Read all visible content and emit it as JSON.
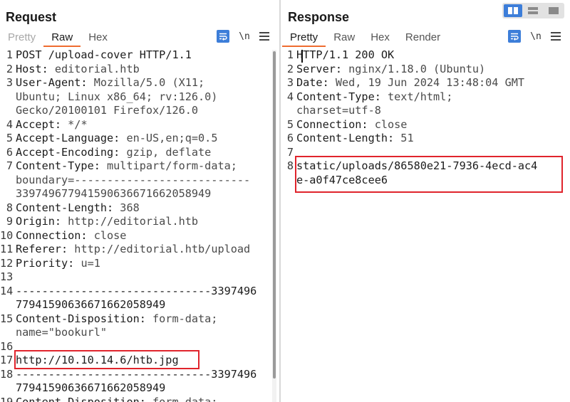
{
  "request": {
    "title": "Request",
    "tabs": [
      {
        "label": "Pretty",
        "state": "disabled"
      },
      {
        "label": "Raw",
        "state": "active"
      },
      {
        "label": "Hex",
        "state": "normal"
      }
    ],
    "newline_label": "\\n",
    "lines": [
      {
        "num": "1",
        "key": "POST /upload-cover HTTP/1.1",
        "val": ""
      },
      {
        "num": "2",
        "key": "Host:",
        "val": " editorial.htb"
      },
      {
        "num": "3",
        "key": "User-Agent:",
        "val": " Mozilla/5.0 (X11;"
      },
      {
        "num": "",
        "key": "",
        "val": "Ubuntu; Linux x86_64; rv:126.0)"
      },
      {
        "num": "",
        "key": "",
        "val": "Gecko/20100101 Firefox/126.0"
      },
      {
        "num": "4",
        "key": "Accept:",
        "val": " */*"
      },
      {
        "num": "5",
        "key": "Accept-Language:",
        "val": " en-US,en;q=0.5"
      },
      {
        "num": "6",
        "key": "Accept-Encoding:",
        "val": " gzip, deflate"
      },
      {
        "num": "7",
        "key": "Content-Type:",
        "val": " multipart/form-data;"
      },
      {
        "num": "",
        "key": "",
        "val": "boundary=---------------------------"
      },
      {
        "num": "",
        "key": "",
        "val": "339749677941590636671662058949"
      },
      {
        "num": "8",
        "key": "Content-Length:",
        "val": " 368"
      },
      {
        "num": "9",
        "key": "Origin:",
        "val": " http://editorial.htb"
      },
      {
        "num": "10",
        "key": "Connection:",
        "val": " close"
      },
      {
        "num": "11",
        "key": "Referer:",
        "val": " http://editorial.htb/upload"
      },
      {
        "num": "12",
        "key": "Priority:",
        "val": " u=1"
      },
      {
        "num": "13",
        "key": "",
        "val": ""
      },
      {
        "num": "14",
        "key": "------------------------------3397496",
        "val": ""
      },
      {
        "num": "",
        "key": "77941590636671662058949",
        "val": ""
      },
      {
        "num": "15",
        "key": "Content-Disposition:",
        "val": " form-data;"
      },
      {
        "num": "",
        "key": "",
        "val": "name=\"bookurl\""
      },
      {
        "num": "16",
        "key": "",
        "val": ""
      },
      {
        "num": "17",
        "key": "http://10.10.14.6/htb.jpg",
        "val": ""
      },
      {
        "num": "18",
        "key": "------------------------------3397496",
        "val": ""
      },
      {
        "num": "",
        "key": "77941590636671662058949",
        "val": ""
      },
      {
        "num": "19",
        "key": "Content-Disposition:",
        "val": " form-data;"
      }
    ]
  },
  "response": {
    "title": "Response",
    "tabs": [
      {
        "label": "Pretty",
        "state": "active"
      },
      {
        "label": "Raw",
        "state": "normal"
      },
      {
        "label": "Hex",
        "state": "normal"
      },
      {
        "label": "Render",
        "state": "normal"
      }
    ],
    "newline_label": "\\n",
    "lines": [
      {
        "num": "1",
        "key": "HTTP/1.1 200 OK",
        "val": ""
      },
      {
        "num": "2",
        "key": "Server:",
        "val": " nginx/1.18.0 (Ubuntu)"
      },
      {
        "num": "3",
        "key": "Date:",
        "val": " Wed, 19 Jun 2024 13:48:04 GMT"
      },
      {
        "num": "4",
        "key": "Content-Type:",
        "val": " text/html;"
      },
      {
        "num": "",
        "key": "",
        "val": "charset=utf-8"
      },
      {
        "num": "5",
        "key": "Connection:",
        "val": " close"
      },
      {
        "num": "6",
        "key": "Content-Length:",
        "val": " 51"
      },
      {
        "num": "7",
        "key": "",
        "val": ""
      },
      {
        "num": "8",
        "key": "static/uploads/86580e21-7936-4ecd-ac4",
        "val": ""
      },
      {
        "num": "",
        "key": "e-a0f47ce8cee6",
        "val": ""
      }
    ]
  },
  "colors": {
    "accent": "#3d7ed9",
    "tab_underline": "#ef6c2f",
    "highlight": "#e0242c"
  },
  "icons": {
    "wrap": "wrap-lines-icon",
    "menu": "hamburger-menu-icon",
    "layout": [
      "side-by-side-layout-icon",
      "stacked-layout-icon",
      "single-pane-layout-icon"
    ]
  }
}
